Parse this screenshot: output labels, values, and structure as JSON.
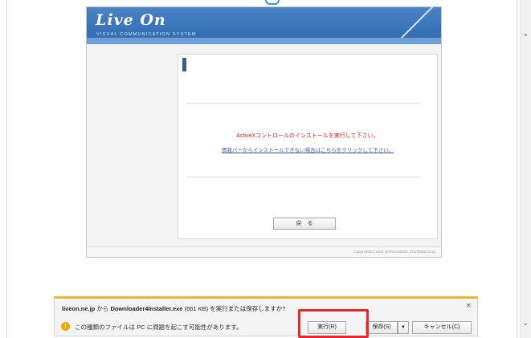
{
  "app": {
    "logo": "Live On",
    "tagline": "VISUAL COMMUNICATION SYSTEM",
    "message_red": "ActiveXコントロールのインストールを実行して下さい。",
    "message_link": "情報バーからインストールできない場合はこちらをクリックして下さい。",
    "back_button": "戻　る",
    "copyright": "Copyright(C) 2004 JAPAN MEDIA SYSTEMS Corp."
  },
  "download_bar": {
    "site": "liveon.ne.jp",
    "from_text": " から ",
    "filename": "Downloader4Installer.exe",
    "size_text": " (661 KB) を実行または保存しますか?",
    "warning_text": "この種類のファイルは PC に問題を起こす可能性があります。",
    "run_label": "実行(R)",
    "save_label": "保存(S)",
    "save_dropdown": "▼",
    "cancel_label": "キャンセル(C)",
    "close_label": "×"
  },
  "icons": {
    "warning": "warning-icon",
    "close": "close-icon"
  },
  "colors": {
    "brand_blue": "#2d67ad",
    "error_red": "#d42020",
    "link_blue": "#3b5fb8",
    "highlight": "#e82929",
    "notify_accent": "#f2b233"
  }
}
